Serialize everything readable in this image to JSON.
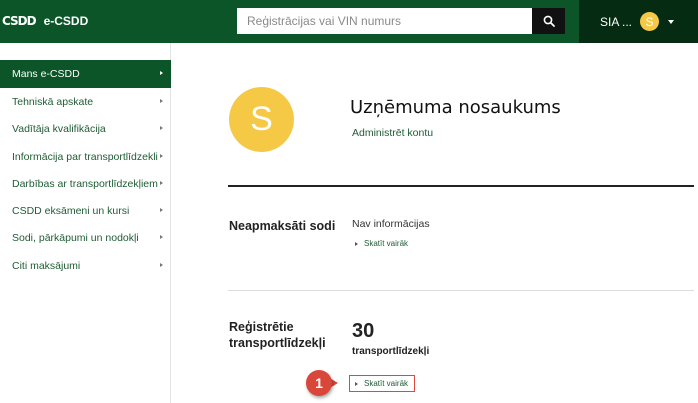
{
  "header": {
    "logo_mark": "CSDD",
    "app_title": "e-CSDD",
    "search_placeholder": "Reģistrācijas vai VIN numurs",
    "user_name": "SIA ...",
    "user_initial": "S"
  },
  "sidebar": {
    "items": [
      {
        "label": "Mans e-CSDD",
        "active": true
      },
      {
        "label": "Tehniskā apskate"
      },
      {
        "label": "Vadītāja kvalifikācija"
      },
      {
        "label": "Informācija par transportlīdzekli"
      },
      {
        "label": "Darbības ar transportlīdzekļiem"
      },
      {
        "label": "CSDD eksāmeni un kursi"
      },
      {
        "label": "Sodi, pārkāpumi un nodokļi"
      },
      {
        "label": "Citi maksājumi"
      }
    ]
  },
  "profile": {
    "initial": "S",
    "company_name": "Uzņēmuma nosaukums",
    "admin_link": "Administrēt kontu"
  },
  "fines": {
    "title": "Neapmaksāti sodi",
    "status": "Nav informācijas",
    "more_link": "Skatīt vairāk"
  },
  "vehicles": {
    "title_line1": "Reģistrētie",
    "title_line2": "transportlīdzekļi",
    "count": "30",
    "count_label": "transportlīdzekļi",
    "more_link": "Skatīt vairāk"
  },
  "annotation": {
    "number": "1",
    "color": "#d9463a"
  },
  "colors": {
    "brand_green": "#0c5528",
    "dark_green": "#062b13",
    "avatar_yellow": "#f5c945"
  }
}
